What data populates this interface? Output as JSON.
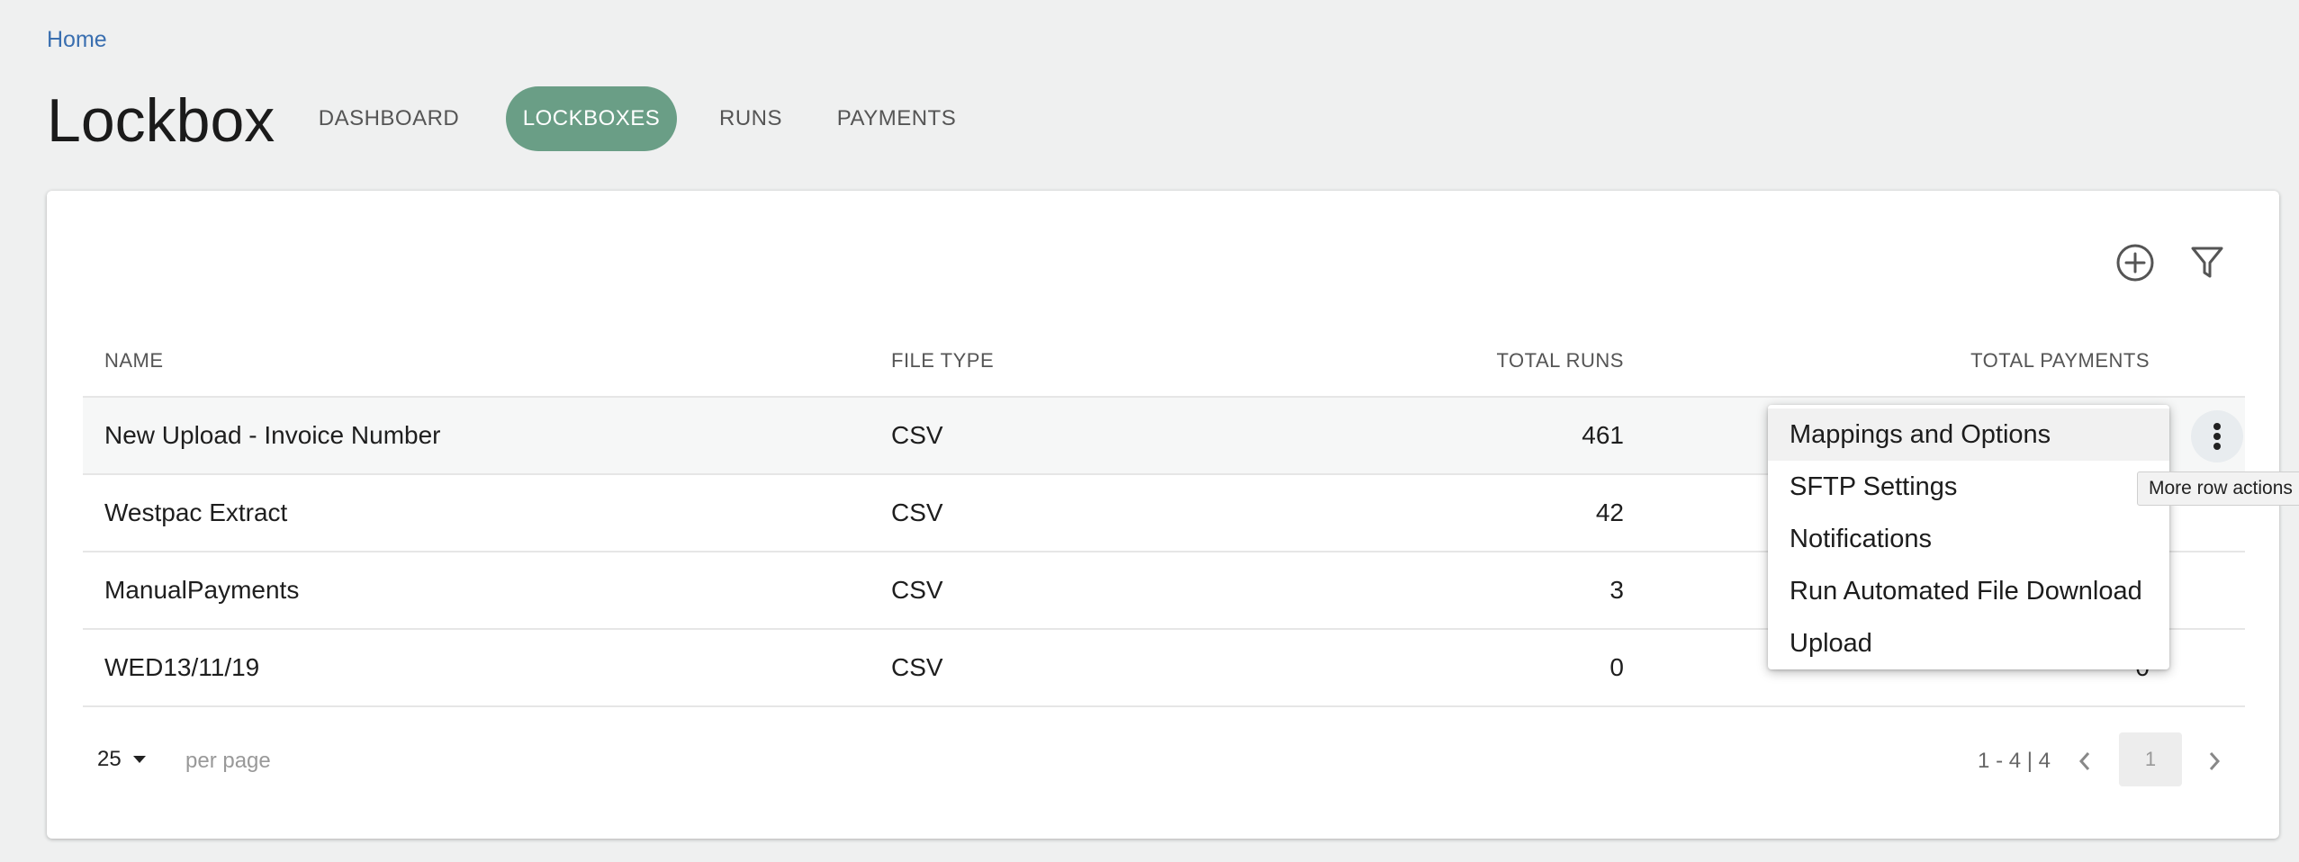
{
  "breadcrumb": {
    "home": "Home"
  },
  "page": {
    "title": "Lockbox"
  },
  "tabs": [
    {
      "label": "DASHBOARD",
      "active": false
    },
    {
      "label": "LOCKBOXES",
      "active": true
    },
    {
      "label": "RUNS",
      "active": false
    },
    {
      "label": "PAYMENTS",
      "active": false
    }
  ],
  "toolbar": {
    "add_icon": "plus-circle-icon",
    "filter_icon": "filter-icon"
  },
  "table": {
    "columns": [
      "NAME",
      "FILE TYPE",
      "TOTAL RUNS",
      "TOTAL PAYMENTS"
    ],
    "rows": [
      {
        "name": "New Upload - Invoice Number",
        "file_type": "CSV",
        "total_runs": "461",
        "total_payments": ""
      },
      {
        "name": "Westpac Extract",
        "file_type": "CSV",
        "total_runs": "42",
        "total_payments": ""
      },
      {
        "name": "ManualPayments",
        "file_type": "CSV",
        "total_runs": "3",
        "total_payments": ""
      },
      {
        "name": "WED13/11/19",
        "file_type": "CSV",
        "total_runs": "0",
        "total_payments": "0"
      }
    ]
  },
  "row_menu": {
    "items": [
      "Mappings and Options",
      "SFTP Settings",
      "Notifications",
      "Run Automated File Download",
      "Upload"
    ]
  },
  "tooltip": {
    "text": "More row actions"
  },
  "pagination": {
    "per_page_value": "25",
    "per_page_label": "per page",
    "range": "1 - 4 | 4",
    "current_page": "1"
  },
  "colors": {
    "accent": "#6a9e86",
    "link": "#3a6fb0",
    "background": "#eff0f0"
  }
}
